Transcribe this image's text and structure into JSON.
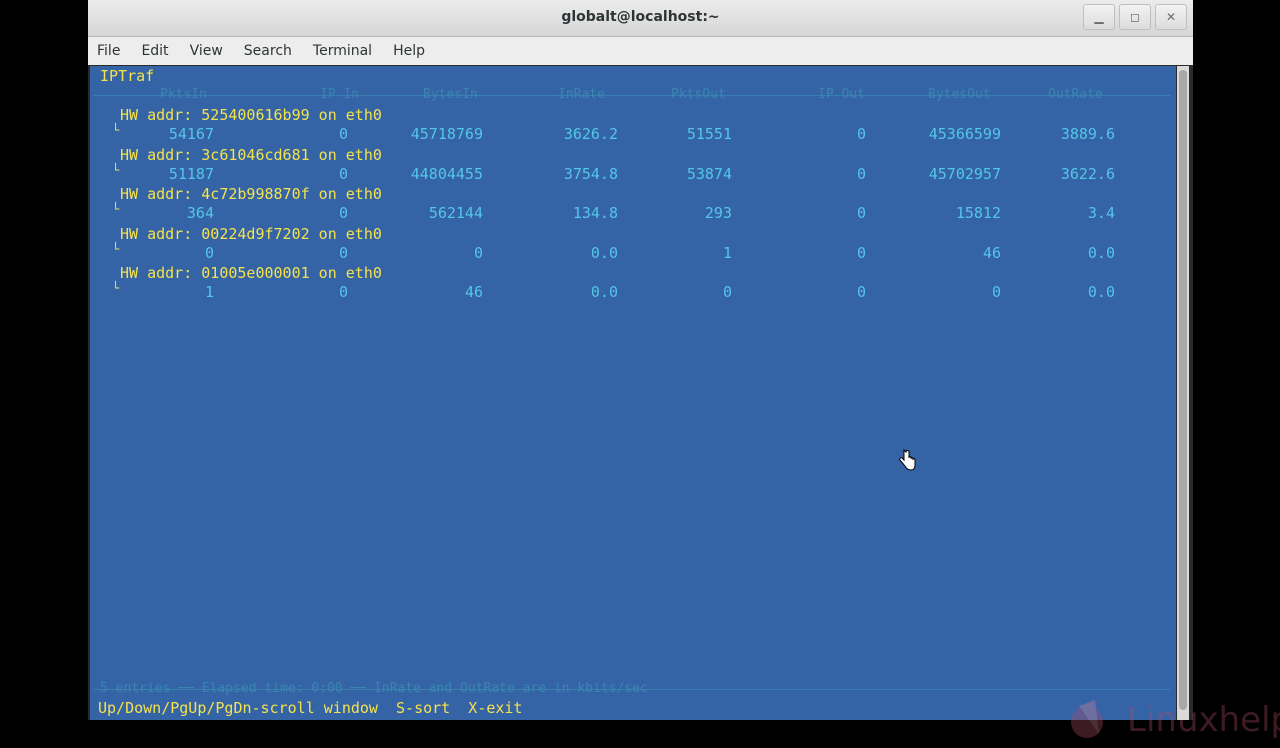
{
  "window": {
    "title": "globalt@localhost:~"
  },
  "menu": [
    "File",
    "Edit",
    "View",
    "Search",
    "Terminal",
    "Help"
  ],
  "app": {
    "name": "IPTraf"
  },
  "header": {
    "columns": [
      "PktsIn",
      "IP In",
      "BytesIn",
      "InRate",
      "PktsOut",
      "IP Out",
      "BytesOut",
      "OutRate"
    ]
  },
  "entries": [
    {
      "label": "HW addr: 525400616b99 on eth0",
      "values": [
        "54167",
        "0",
        "45718769",
        "3626.2",
        "51551",
        "0",
        "45366599",
        "3889.6"
      ]
    },
    {
      "label": "HW addr: 3c61046cd681 on eth0",
      "values": [
        "51187",
        "0",
        "44804455",
        "3754.8",
        "53874",
        "0",
        "45702957",
        "3622.6"
      ]
    },
    {
      "label": "HW addr: 4c72b998870f on eth0",
      "values": [
        "364",
        "0",
        "562144",
        "134.8",
        "293",
        "0",
        "15812",
        "3.4"
      ]
    },
    {
      "label": "HW addr: 00224d9f7202 on eth0",
      "values": [
        "0",
        "0",
        "0",
        "0.0",
        "1",
        "0",
        "46",
        "0.0"
      ]
    },
    {
      "label": "HW addr: 01005e000001 on eth0",
      "values": [
        "1",
        "0",
        "46",
        "0.0",
        "0",
        "0",
        "0",
        "0.0"
      ]
    }
  ],
  "footer": {
    "info": "5 entries ── Elapsed time: 0:00 ── InRate and OutRate are in kbits/sec"
  },
  "status": "Up/Down/PgUp/PgDn-scroll window  S-sort  X-exit",
  "watermark": "Linuxhelp",
  "colors": {
    "terminal_bg": "#3464a5",
    "highlight": "#f5e24c",
    "data": "#54c6e8"
  }
}
